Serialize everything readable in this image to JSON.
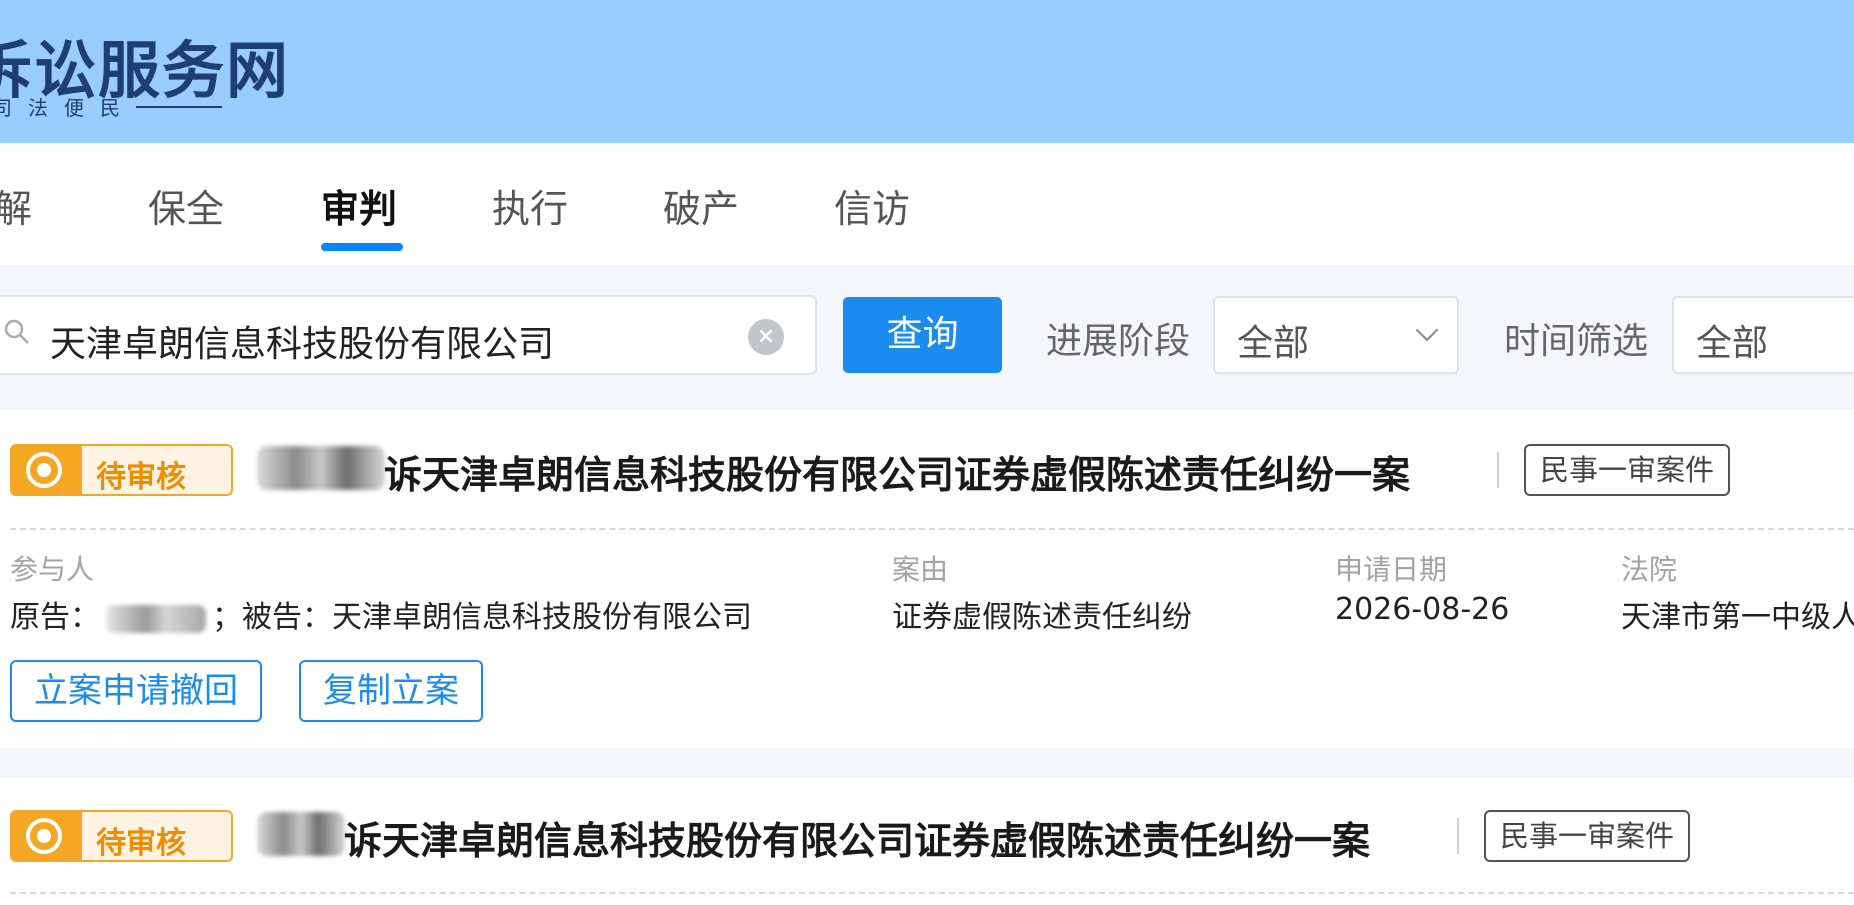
{
  "header": {
    "logo_title": "诉讼服务网",
    "logo_subtitle": "司法便民"
  },
  "tabs": [
    {
      "label": "调解",
      "active": false
    },
    {
      "label": "保全",
      "active": false
    },
    {
      "label": "审判",
      "active": true
    },
    {
      "label": "执行",
      "active": false
    },
    {
      "label": "破产",
      "active": false
    },
    {
      "label": "信访",
      "active": false
    }
  ],
  "search": {
    "value": "天津卓朗信息科技股份有限公司",
    "query_button": "查询"
  },
  "filters": {
    "stage_label": "进展阶段",
    "stage_value": "全部",
    "time_label": "时间筛选",
    "time_value": "全部"
  },
  "cards": [
    {
      "status": "待审核",
      "title": "诉天津卓朗信息科技股份有限公司证券虚假陈述责任纠纷一案",
      "case_type": "民事一审案件",
      "participants_label": "参与人",
      "participants_plaintiff_prefix": "原告：",
      "participants_defendant": "；被告：天津卓朗信息科技股份有限公司",
      "cause_label": "案由",
      "cause_value": "证券虚假陈述责任纠纷",
      "date_label": "申请日期",
      "date_value": "2026-08-26",
      "court_label": "法院",
      "court_value": "天津市第一中级人",
      "actions": [
        "立案申请撤回",
        "复制立案"
      ]
    },
    {
      "status": "待审核",
      "title": "诉天津卓朗信息科技股份有限公司证券虚假陈述责任纠纷一案",
      "case_type": "民事一审案件"
    }
  ],
  "colors": {
    "header_bg": "#99ccff",
    "accent": "#1a8cf0",
    "status_orange": "#f5a623"
  }
}
